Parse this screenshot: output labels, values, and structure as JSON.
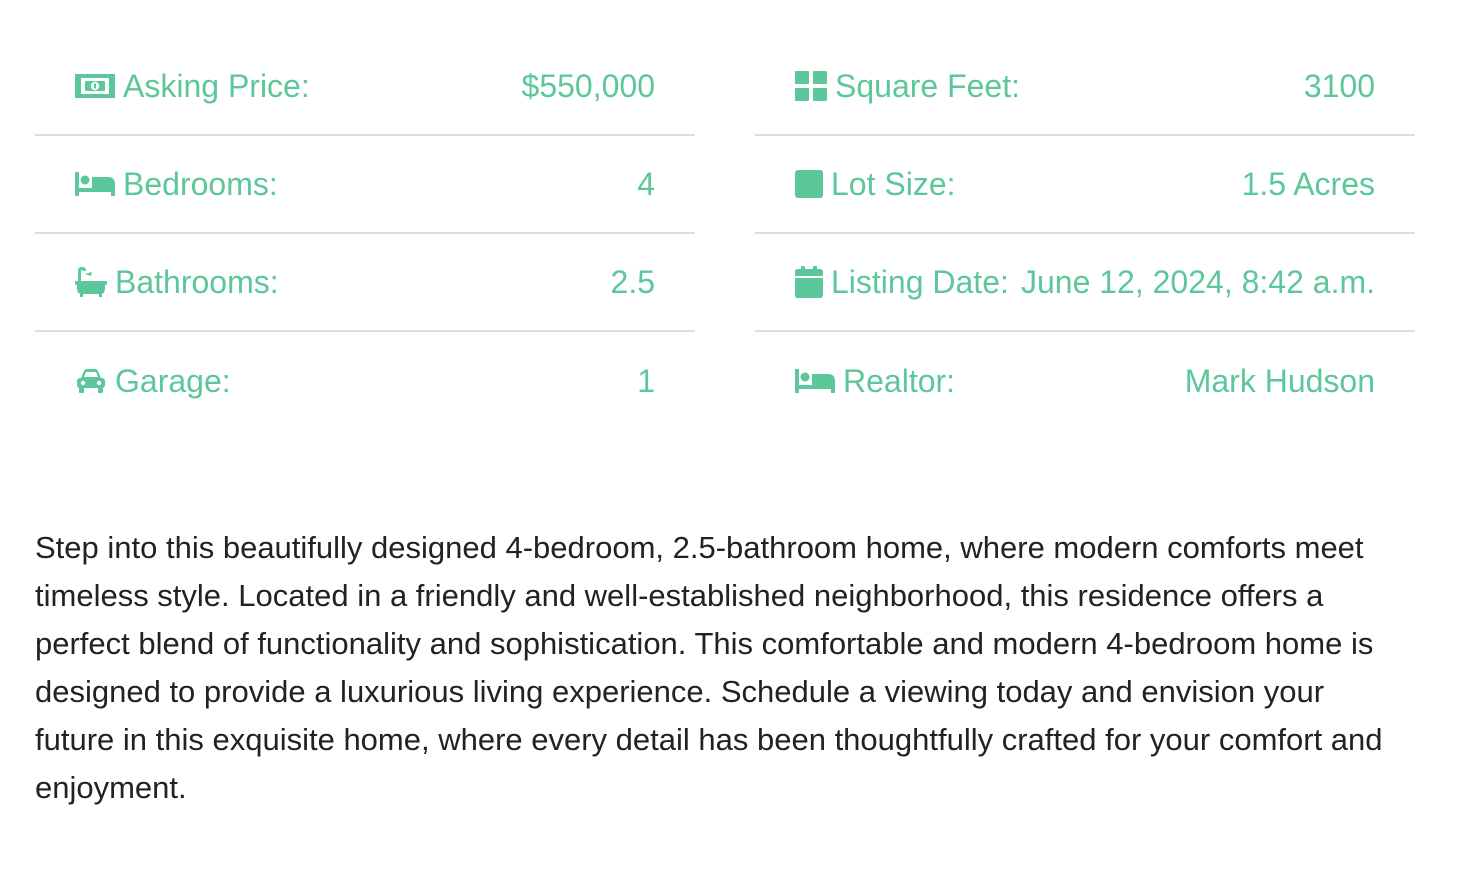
{
  "accent_color": "#5cc79a",
  "details": {
    "left": [
      {
        "icon": "money-bill-icon",
        "label": "Asking Price:",
        "value": "$550,000"
      },
      {
        "icon": "bed-icon",
        "label": "Bedrooms:",
        "value": "4"
      },
      {
        "icon": "bath-icon",
        "label": "Bathrooms:",
        "value": "2.5"
      },
      {
        "icon": "car-icon",
        "label": "Garage:",
        "value": "1"
      }
    ],
    "right": [
      {
        "icon": "grid-icon",
        "label": "Square Feet:",
        "value": "3100"
      },
      {
        "icon": "square-icon",
        "label": "Lot Size:",
        "value": "1.5 Acres"
      },
      {
        "icon": "calendar-icon",
        "label": "Listing Date:",
        "value": "June 12, 2024, 8:42 a.m."
      },
      {
        "icon": "bed-icon",
        "label": "Realtor:",
        "value": "Mark Hudson"
      }
    ]
  },
  "description": "Step into this beautifully designed 4-bedroom, 2.5-bathroom home, where modern comforts meet timeless style. Located in a friendly and well-established neighborhood, this residence offers a perfect blend of functionality and sophistication. This comfortable and modern 4-bedroom home is designed to provide a luxurious living experience. Schedule a viewing today and envision your future in this exquisite home, where every detail has been thoughtfully crafted for your comfort and enjoyment."
}
